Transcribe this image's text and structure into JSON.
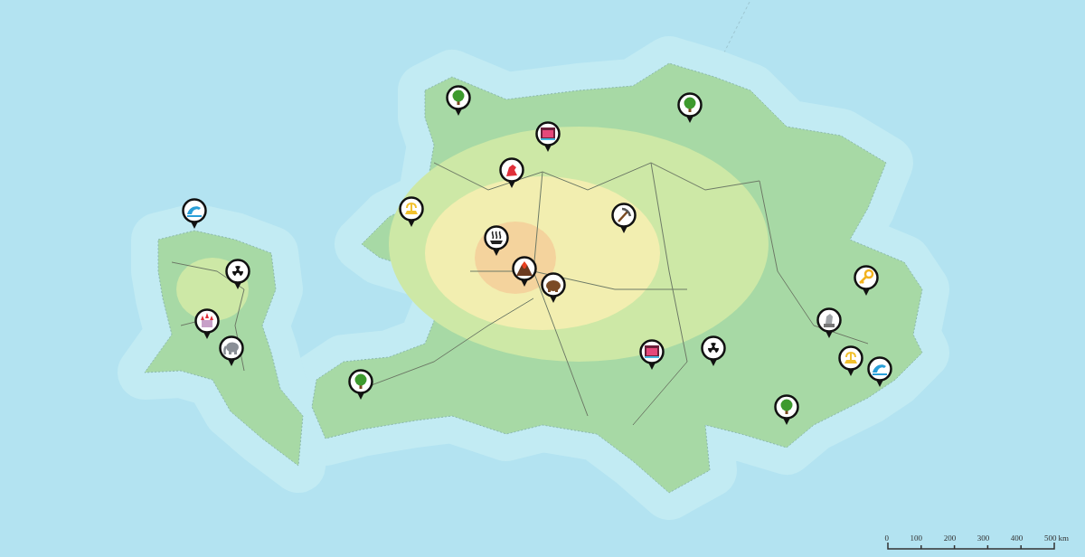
{
  "map": {
    "markers": [
      {
        "kind": "tree"
      },
      {
        "kind": "tree"
      },
      {
        "kind": "gate"
      },
      {
        "kind": "dragon"
      },
      {
        "kind": "fountain"
      },
      {
        "kind": "dolphin"
      },
      {
        "kind": "pickaxe"
      },
      {
        "kind": "hot-spring"
      },
      {
        "kind": "radiation"
      },
      {
        "kind": "volcano"
      },
      {
        "kind": "mammoth"
      },
      {
        "kind": "key"
      },
      {
        "kind": "castle"
      },
      {
        "kind": "statue"
      },
      {
        "kind": "elephant"
      },
      {
        "kind": "gate"
      },
      {
        "kind": "radiation"
      },
      {
        "kind": "fountain"
      },
      {
        "kind": "dolphin"
      },
      {
        "kind": "tree"
      },
      {
        "kind": "tree"
      }
    ]
  },
  "scale_bar": {
    "labels": [
      "0",
      "100",
      "200",
      "300",
      "400",
      "500"
    ],
    "unit": "km"
  }
}
